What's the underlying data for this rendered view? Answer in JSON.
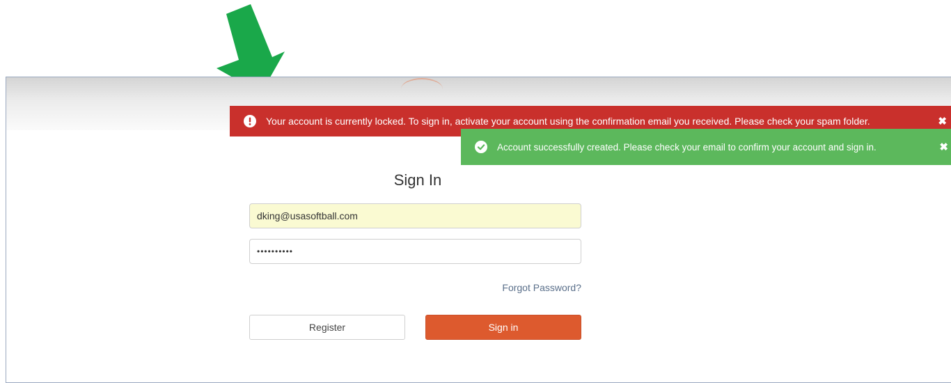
{
  "annotation": {
    "arrow_color": "#1aa84a",
    "icon": "arrow-down-left-icon"
  },
  "alerts": {
    "error": {
      "icon": "exclamation-circle-icon",
      "message": "Your account is currently locked. To sign in, activate your account using the confirmation email you received. Please check your spam folder.",
      "close_label": "✖",
      "color": "#c9302c"
    },
    "success": {
      "icon": "check-circle-icon",
      "message": "Account successfully created. Please check your email to confirm your account and sign in.",
      "close_label": "✖",
      "color": "#5cb85c"
    }
  },
  "form": {
    "title": "Sign In",
    "email_value": "dking@usasoftball.com",
    "password_value": "••••••••••",
    "forgot_label": "Forgot Password?",
    "register_label": "Register",
    "signin_label": "Sign in",
    "signin_color": "#dd5a2e"
  }
}
